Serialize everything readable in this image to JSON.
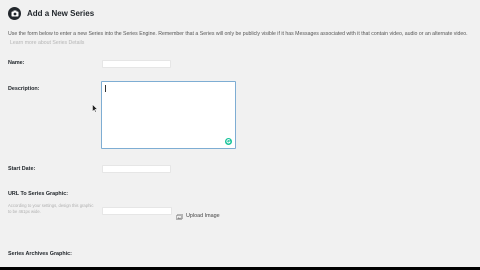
{
  "header": {
    "title": "Add a New Series",
    "icon": "camera-icon"
  },
  "intro": {
    "text": "Use the form below to enter a new Series into the Series Engine. Remember that a Series will only be publicly visible if it has Messages associated with it that contain video, audio or an alternate video.",
    "link": "Learn more about Series Details"
  },
  "form": {
    "name_label": "Name:",
    "name_value": "",
    "description_label": "Description:",
    "description_value": "",
    "start_date_label": "Start Date:",
    "start_date_value": "",
    "url_graphic_label": "URL To Series Graphic:",
    "url_graphic_help": "According to your settings, design this graphic to be 461px wide.",
    "url_graphic_value": "",
    "upload_label": "Upload Image",
    "archives_graphic_label": "Series Archives Graphic:"
  },
  "colors": {
    "accent_border": "#7eadd3",
    "grammar_badge": "#15c39a"
  }
}
